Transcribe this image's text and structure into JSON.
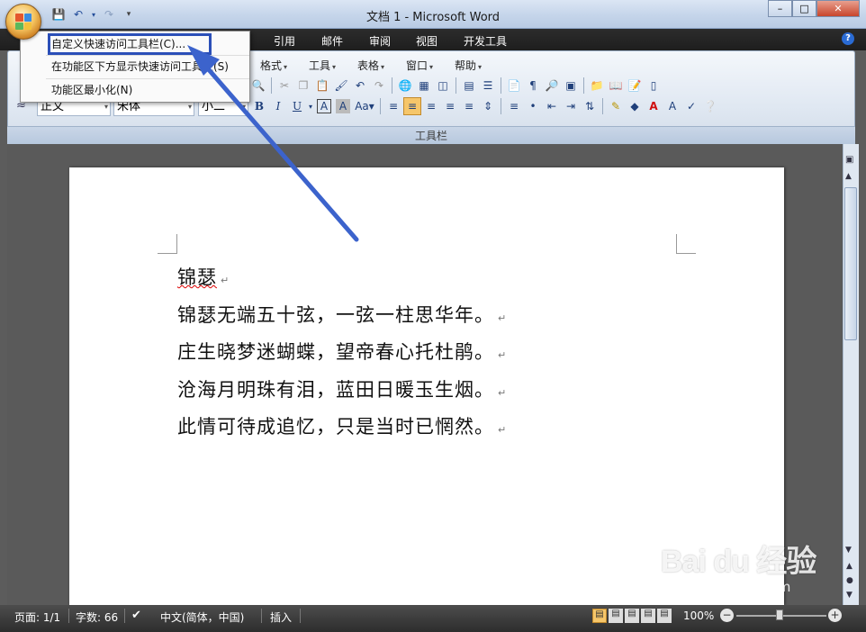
{
  "window": {
    "title": "文档 1 - Microsoft Word"
  },
  "tabs": [
    "引用",
    "邮件",
    "审阅",
    "视图",
    "开发工具"
  ],
  "menu_bar": [
    "格式",
    "工具",
    "表格",
    "窗口",
    "帮助"
  ],
  "format_bar": {
    "style": "正文",
    "font": "宋体",
    "size": "小二"
  },
  "ribbon_group": "工具栏",
  "context_menu": [
    "自定义快速访问工具栏(C)...",
    "在功能区下方显示快速访问工具栏(S)",
    "功能区最小化(N)"
  ],
  "document": {
    "lines": [
      "锦瑟",
      "锦瑟无端五十弦，一弦一柱思华年。",
      "庄生晓梦迷蝴蝶，望帝春心托杜鹃。",
      "沧海月明珠有泪，蓝田日暖玉生烟。",
      "此情可待成追忆，只是当时已惘然。"
    ],
    "pilcrow": "↵"
  },
  "status": {
    "page": "页面: 1/1",
    "words": "字数: 66",
    "language": "中文(简体，中国)",
    "mode": "插入",
    "zoom": "100%"
  },
  "watermark": {
    "logo": "Bai du 经验",
    "url": "jingyan.baidu.com"
  },
  "icons": {
    "help": "?",
    "minimize": "–",
    "maximize": "□",
    "close": "✕"
  }
}
